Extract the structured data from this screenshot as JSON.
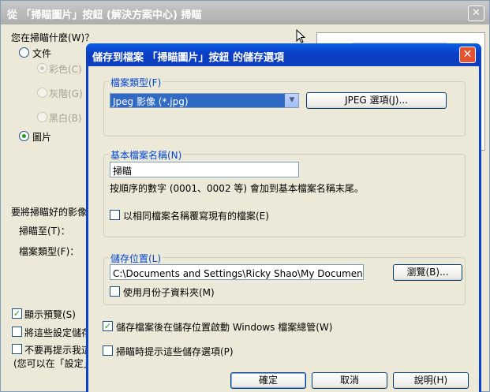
{
  "background_dialog": {
    "title": "從 「掃瞄圖片」按鈕 (解決方案中心) 掃瞄",
    "close": "✕",
    "scan_what_label": "您在掃瞄什麼(W)？",
    "doc_option": "文件",
    "color_option": "彩色(C)",
    "grey_option": "灰階(G)",
    "bw_option": "黑白(B)",
    "picture_option": "圖片",
    "save_image_label": "要將掃瞄好的影像",
    "scan_to_label": "掃瞄至(T)：",
    "file_type_label": "檔案類型(F)：",
    "show_preview": "顯示預覽(S)",
    "save_settings": "將這些設定儲存",
    "no_prompt": "不要再提示我這",
    "note": "(您可以在「設定」"
  },
  "dialog": {
    "title": "儲存到檔案 「掃瞄圖片」按鈕 的儲存選項",
    "close": "✕",
    "file_type_group": "檔案類型(F)",
    "file_type_value": "Jpeg 影像 (*.jpg)",
    "jpeg_options_button": "JPEG 選項(J)...",
    "basename_group": "基本檔案名稱(N)",
    "basename_value": "掃瞄",
    "basename_hint": "按順序的數字 (0001、0002 等) 會加到基本檔案名稱末尾。",
    "overwrite_checkbox": "以相同檔案名稱覆寫現有的檔案(E)",
    "location_group": "儲存位置(L)",
    "location_value": "C:\\Documents and Settings\\Ricky Shao\\My Documents\\我的掃瞄\\",
    "browse_button": "瀏覽(B)...",
    "month_subfolder_checkbox": "使用月份子資料夾(M)",
    "launch_explorer_checkbox": "儲存檔案後在儲存位置啟動 Windows 檔案總管(W)",
    "prompt_options_checkbox": "掃瞄時提示這些儲存選項(P)",
    "ok_button": "確定",
    "cancel_button": "取消",
    "help_button": "說明(H)"
  },
  "icons": {
    "dropdown": "▼",
    "check": "✓"
  }
}
